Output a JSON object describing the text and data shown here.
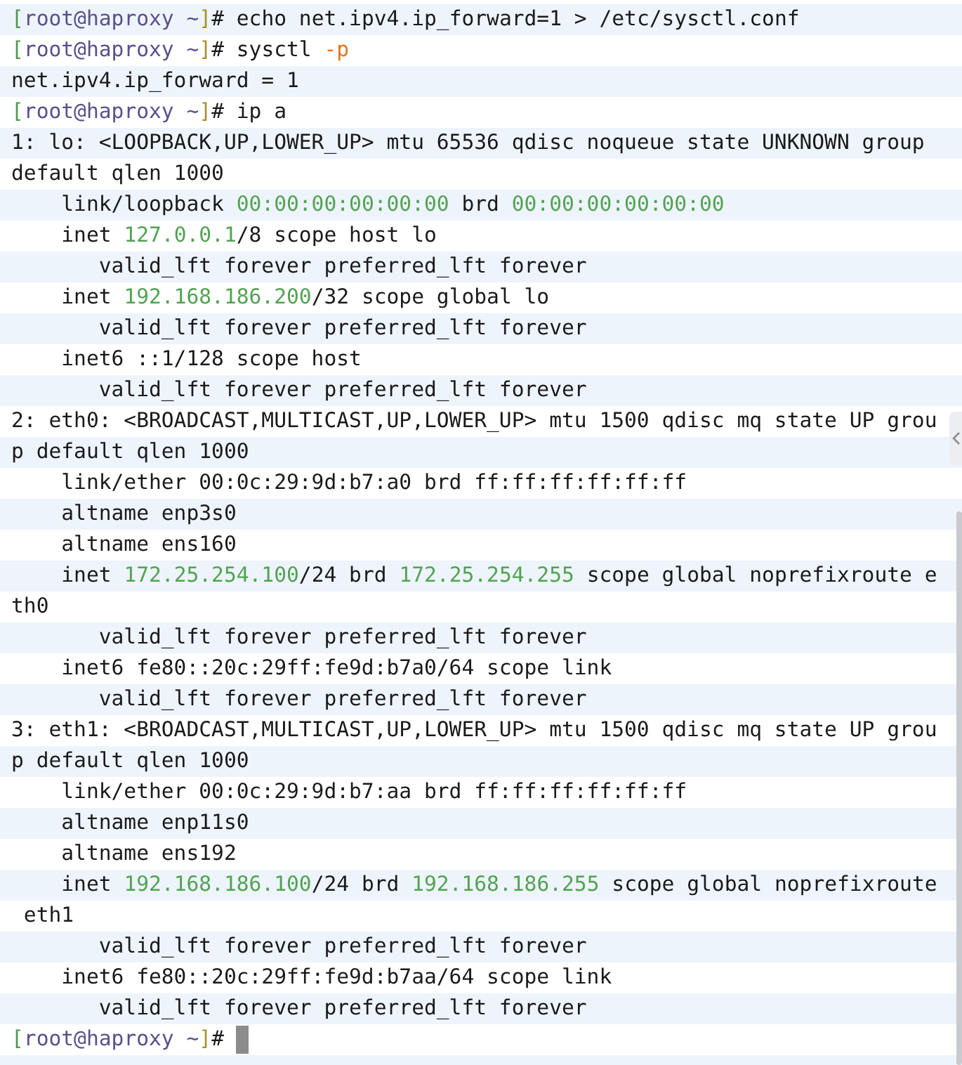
{
  "terminal": {
    "lines": [
      {
        "segments": [
          {
            "kind": "bracket-open",
            "text": "["
          },
          {
            "kind": "user",
            "text": "root@haproxy ~"
          },
          {
            "kind": "bracket-close",
            "text": "]"
          },
          {
            "kind": "plain",
            "text": "# echo net.ipv4.ip_forward=1 > /etc/sysctl.conf"
          }
        ]
      },
      {
        "segments": [
          {
            "kind": "bracket-open",
            "text": "["
          },
          {
            "kind": "user",
            "text": "root@haproxy ~"
          },
          {
            "kind": "bracket-close",
            "text": "]"
          },
          {
            "kind": "plain",
            "text": "# sysctl "
          },
          {
            "kind": "option",
            "text": "-p"
          }
        ]
      },
      {
        "segments": [
          {
            "kind": "plain",
            "text": "net.ipv4.ip_forward = 1"
          }
        ]
      },
      {
        "segments": [
          {
            "kind": "bracket-open",
            "text": "["
          },
          {
            "kind": "user",
            "text": "root@haproxy ~"
          },
          {
            "kind": "bracket-close",
            "text": "]"
          },
          {
            "kind": "plain",
            "text": "# ip a"
          }
        ]
      },
      {
        "segments": [
          {
            "kind": "plain",
            "text": "1: lo: <LOOPBACK,UP,LOWER_UP> mtu 65536 qdisc noqueue state UNKNOWN group"
          }
        ]
      },
      {
        "segments": [
          {
            "kind": "plain",
            "text": "default qlen 1000"
          }
        ]
      },
      {
        "segments": [
          {
            "kind": "plain",
            "text": "    link/loopback "
          },
          {
            "kind": "address",
            "text": "00:00:00:00:00:00"
          },
          {
            "kind": "plain",
            "text": " brd "
          },
          {
            "kind": "address",
            "text": "00:00:00:00:00:00"
          }
        ]
      },
      {
        "segments": [
          {
            "kind": "plain",
            "text": "    inet "
          },
          {
            "kind": "address",
            "text": "127.0.0.1"
          },
          {
            "kind": "plain",
            "text": "/8 scope host lo"
          }
        ]
      },
      {
        "segments": [
          {
            "kind": "plain",
            "text": "       valid_lft forever preferred_lft forever"
          }
        ]
      },
      {
        "segments": [
          {
            "kind": "plain",
            "text": "    inet "
          },
          {
            "kind": "address",
            "text": "192.168.186.200"
          },
          {
            "kind": "plain",
            "text": "/32 scope global lo"
          }
        ]
      },
      {
        "segments": [
          {
            "kind": "plain",
            "text": "       valid_lft forever preferred_lft forever"
          }
        ]
      },
      {
        "segments": [
          {
            "kind": "plain",
            "text": "    inet6 ::1/128 scope host"
          }
        ]
      },
      {
        "segments": [
          {
            "kind": "plain",
            "text": "       valid_lft forever preferred_lft forever"
          }
        ]
      },
      {
        "segments": [
          {
            "kind": "plain",
            "text": "2: eth0: <BROADCAST,MULTICAST,UP,LOWER_UP> mtu 1500 qdisc mq state UP grou"
          }
        ]
      },
      {
        "segments": [
          {
            "kind": "plain",
            "text": "p default qlen 1000"
          }
        ]
      },
      {
        "segments": [
          {
            "kind": "plain",
            "text": "    link/ether 00:0c:29:9d:b7:a0 brd ff:ff:ff:ff:ff:ff"
          }
        ]
      },
      {
        "segments": [
          {
            "kind": "plain",
            "text": "    altname enp3s0"
          }
        ]
      },
      {
        "segments": [
          {
            "kind": "plain",
            "text": "    altname ens160"
          }
        ]
      },
      {
        "segments": [
          {
            "kind": "plain",
            "text": "    inet "
          },
          {
            "kind": "address",
            "text": "172.25.254.100"
          },
          {
            "kind": "plain",
            "text": "/24 brd "
          },
          {
            "kind": "address",
            "text": "172.25.254.255"
          },
          {
            "kind": "plain",
            "text": " scope global noprefixroute e"
          }
        ]
      },
      {
        "segments": [
          {
            "kind": "plain",
            "text": "th0"
          }
        ]
      },
      {
        "segments": [
          {
            "kind": "plain",
            "text": "       valid_lft forever preferred_lft forever"
          }
        ]
      },
      {
        "segments": [
          {
            "kind": "plain",
            "text": "    inet6 fe80::20c:29ff:fe9d:b7a0/64 scope link"
          }
        ]
      },
      {
        "segments": [
          {
            "kind": "plain",
            "text": "       valid_lft forever preferred_lft forever"
          }
        ]
      },
      {
        "segments": [
          {
            "kind": "plain",
            "text": "3: eth1: <BROADCAST,MULTICAST,UP,LOWER_UP> mtu 1500 qdisc mq state UP grou"
          }
        ]
      },
      {
        "segments": [
          {
            "kind": "plain",
            "text": "p default qlen 1000"
          }
        ]
      },
      {
        "segments": [
          {
            "kind": "plain",
            "text": "    link/ether 00:0c:29:9d:b7:aa brd ff:ff:ff:ff:ff:ff"
          }
        ]
      },
      {
        "segments": [
          {
            "kind": "plain",
            "text": "    altname enp11s0"
          }
        ]
      },
      {
        "segments": [
          {
            "kind": "plain",
            "text": "    altname ens192"
          }
        ]
      },
      {
        "segments": [
          {
            "kind": "plain",
            "text": "    inet "
          },
          {
            "kind": "address",
            "text": "192.168.186.100"
          },
          {
            "kind": "plain",
            "text": "/24 brd "
          },
          {
            "kind": "address",
            "text": "192.168.186.255"
          },
          {
            "kind": "plain",
            "text": " scope global noprefixroute"
          }
        ]
      },
      {
        "segments": [
          {
            "kind": "plain",
            "text": " eth1"
          }
        ]
      },
      {
        "segments": [
          {
            "kind": "plain",
            "text": "       valid_lft forever preferred_lft forever"
          }
        ]
      },
      {
        "segments": [
          {
            "kind": "plain",
            "text": "    inet6 fe80::20c:29ff:fe9d:b7aa/64 scope link"
          }
        ]
      },
      {
        "segments": [
          {
            "kind": "plain",
            "text": "       valid_lft forever preferred_lft forever"
          }
        ]
      },
      {
        "segments": [
          {
            "kind": "bracket-open",
            "text": "["
          },
          {
            "kind": "user",
            "text": "root@haproxy ~"
          },
          {
            "kind": "bracket-close",
            "text": "]"
          },
          {
            "kind": "plain",
            "text": "# "
          }
        ],
        "cursor": true
      }
    ]
  }
}
